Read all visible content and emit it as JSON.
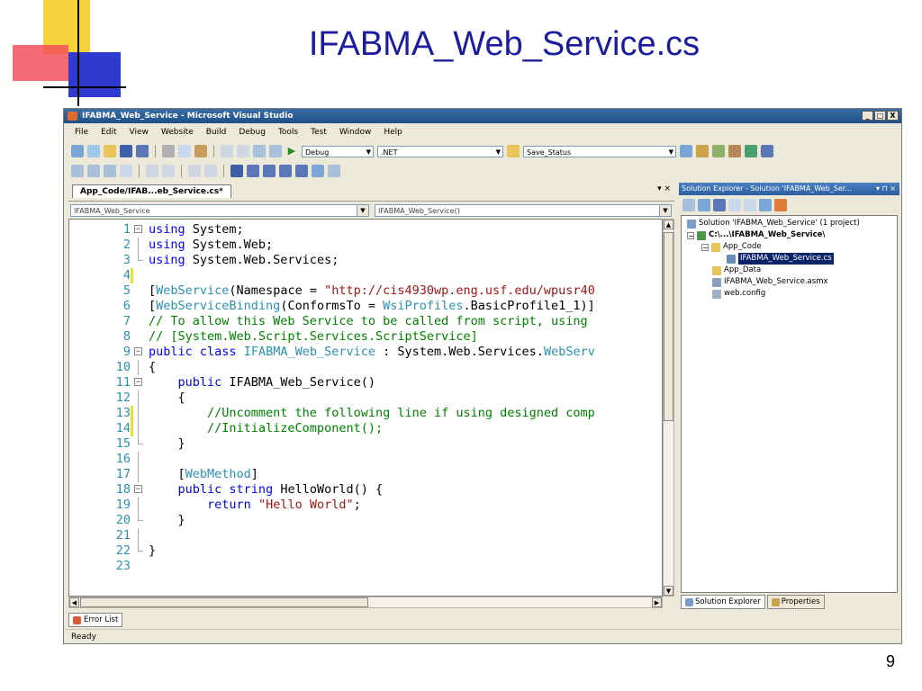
{
  "slide": {
    "title": "IFABMA_Web_Service.cs",
    "page_number": "9"
  },
  "window": {
    "title": "IFABMA_Web_Service - Microsoft Visual Studio",
    "controls": [
      "_",
      "□",
      "X"
    ]
  },
  "menu": [
    "File",
    "Edit",
    "View",
    "Website",
    "Build",
    "Debug",
    "Tools",
    "Test",
    "Window",
    "Help"
  ],
  "toolbar": {
    "config_value": "Debug",
    "platform_value": ".NET",
    "find_value": "Save_Status"
  },
  "editor": {
    "tab_label": "App_Code/IFAB...eb_Service.cs*",
    "tab_controls": "▾ ×",
    "class_combo": "IFABMA_Web_Service",
    "member_combo": "IFABMA_Web_Service()",
    "lines": [
      {
        "n": "1",
        "text": "using System;"
      },
      {
        "n": "2",
        "text": "using System.Web;"
      },
      {
        "n": "3",
        "text": "using System.Web.Services;"
      },
      {
        "n": "4",
        "text": ""
      },
      {
        "n": "5",
        "text": "[WebService(Namespace = \"http://cis4930wp.eng.usf.edu/wpusr40"
      },
      {
        "n": "6",
        "text": "[WebServiceBinding(ConformsTo = WsiProfiles.BasicProfile1_1)]"
      },
      {
        "n": "7",
        "text": "// To allow this Web Service to be called from script, using"
      },
      {
        "n": "8",
        "text": "// [System.Web.Script.Services.ScriptService]"
      },
      {
        "n": "9",
        "text": "public class IFABMA_Web_Service : System.Web.Services.WebServ"
      },
      {
        "n": "10",
        "text": "{"
      },
      {
        "n": "11",
        "text": "    public IFABMA_Web_Service()"
      },
      {
        "n": "12",
        "text": "    {"
      },
      {
        "n": "13",
        "text": "        //Uncomment the following line if using designed comp"
      },
      {
        "n": "14",
        "text": "        //InitializeComponent();"
      },
      {
        "n": "15",
        "text": "    }"
      },
      {
        "n": "16",
        "text": ""
      },
      {
        "n": "17",
        "text": "    [WebMethod]"
      },
      {
        "n": "18",
        "text": "    public string HelloWorld() {"
      },
      {
        "n": "19",
        "text": "        return \"Hello World\";"
      },
      {
        "n": "20",
        "text": "    }"
      },
      {
        "n": "21",
        "text": ""
      },
      {
        "n": "22",
        "text": "}"
      },
      {
        "n": "23",
        "text": ""
      }
    ]
  },
  "solution_explorer": {
    "title": "Solution Explorer - Solution 'IFABMA_Web_Ser...",
    "title_controls": "▾ ⊓ ×",
    "tree": [
      {
        "label": "Solution 'IFABMA_Web_Service' (1 project)"
      },
      {
        "label": "C:\\...\\IFABMA_Web_Service\\"
      },
      {
        "label": "App_Code"
      },
      {
        "label": "IFABMA_Web_Service.cs"
      },
      {
        "label": "App_Data"
      },
      {
        "label": "IFABMA_Web_Service.asmx"
      },
      {
        "label": "web.config"
      }
    ],
    "tabs": [
      "Solution Explorer",
      "Properties"
    ]
  },
  "bottom": {
    "error_list_tab": "Error List",
    "status": "Ready"
  },
  "colors": {
    "keyword": "#0000ff",
    "type": "#2b91af",
    "string": "#a31515",
    "comment": "#008000",
    "title_blue": "#1c1c9e"
  }
}
